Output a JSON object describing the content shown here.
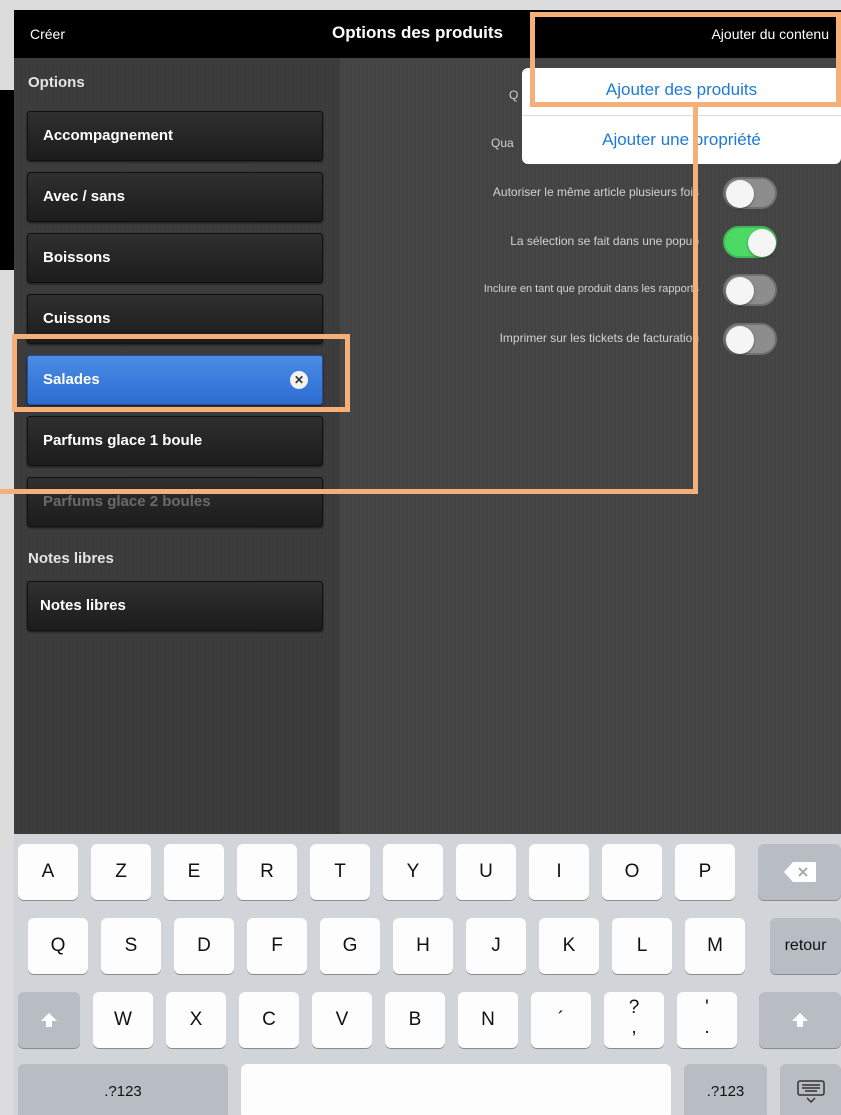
{
  "navbar": {
    "left": "Créer",
    "title": "Options des produits",
    "right": "Ajouter du contenu"
  },
  "sidebar": {
    "options_header": "Options",
    "items": [
      {
        "label": "Accompagnement"
      },
      {
        "label": "Avec / sans"
      },
      {
        "label": "Boissons"
      },
      {
        "label": "Cuissons"
      },
      {
        "label": "Salades",
        "selected": true
      },
      {
        "label": "Parfums glace 1 boule"
      },
      {
        "label": "Parfums glace 2 boules"
      }
    ],
    "notes_header": "Notes libres",
    "notes_item": "Notes libres"
  },
  "content": {
    "hidden_labels": [
      "Q",
      "Qua"
    ],
    "settings": [
      {
        "label": "Autoriser le même article plusieurs fois",
        "on": false
      },
      {
        "label": "La sélection se fait dans une popup",
        "on": true
      },
      {
        "label": "Inclure en tant que produit dans les rapports",
        "on": false
      },
      {
        "label": "Imprimer sur les tickets de facturation",
        "on": false
      }
    ]
  },
  "popover": {
    "item1": "Ajouter des produits",
    "item2": "Ajouter une propriété"
  },
  "keyboard": {
    "row1": [
      "A",
      "Z",
      "E",
      "R",
      "T",
      "Y",
      "U",
      "I",
      "O",
      "P"
    ],
    "row2": [
      "Q",
      "S",
      "D",
      "F",
      "G",
      "H",
      "J",
      "K",
      "L",
      "M"
    ],
    "row2_return": "retour",
    "row3": [
      "W",
      "X",
      "C",
      "V",
      "B",
      "N",
      "´",
      "?\n,",
      "'\n."
    ],
    "row4_left": ".?123",
    "row4_right": ".?123"
  },
  "colors": {
    "highlight": "#f5b07a",
    "accent": "#1e7ad6",
    "toggle_on": "#4cd964"
  }
}
